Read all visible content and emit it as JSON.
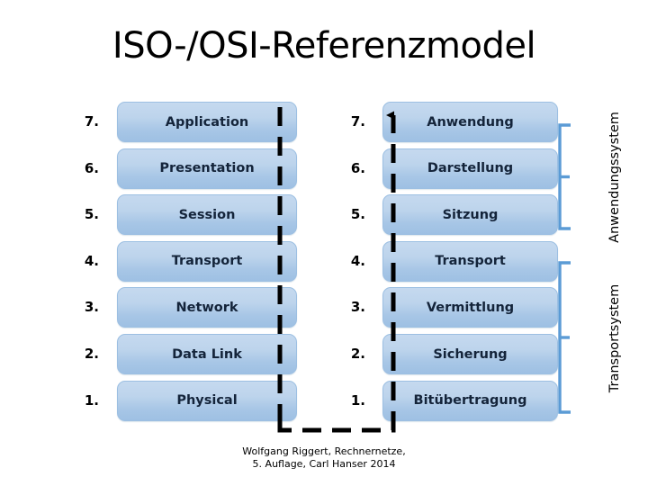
{
  "title": "ISO-/OSI-Referenzmodel",
  "colors": {
    "box_fill_top": "#c5d9ef",
    "box_fill_bottom": "#9ec0e3",
    "box_border": "#9cbfe2",
    "bracket": "#5b9bd5",
    "flow_line": "#000000",
    "text": "#000000",
    "label_text": "#14243a",
    "background": "#ffffff"
  },
  "left_column": {
    "title": "OSI layers English",
    "layers": [
      {
        "number": "7.",
        "name": "Application"
      },
      {
        "number": "6.",
        "name": "Presentation"
      },
      {
        "number": "5.",
        "name": "Session"
      },
      {
        "number": "4.",
        "name": "Transport"
      },
      {
        "number": "3.",
        "name": "Network"
      },
      {
        "number": "2.",
        "name": "Data Link"
      },
      {
        "number": "1.",
        "name": "Physical"
      }
    ]
  },
  "right_column": {
    "title": "OSI Schichten Deutsch",
    "layers": [
      {
        "number": "7.",
        "name": "Anwendung"
      },
      {
        "number": "6.",
        "name": "Darstellung"
      },
      {
        "number": "5.",
        "name": "Sitzung"
      },
      {
        "number": "4.",
        "name": "Transport"
      },
      {
        "number": "3.",
        "name": "Vermittlung"
      },
      {
        "number": "2.",
        "name": "Sicherung"
      },
      {
        "number": "1.",
        "name": "Bitübertragung"
      }
    ]
  },
  "groups": [
    {
      "label": "Anwendungssystem",
      "covers": [
        "7.",
        "6.",
        "5."
      ]
    },
    {
      "label": "Transportsystem",
      "covers": [
        "4.",
        "3.",
        "2.",
        "1."
      ]
    }
  ],
  "flow": {
    "arrow_direction": "up",
    "description": "dashed path rising from layer 1 to layer 7"
  },
  "footer": {
    "line1": "Wolfgang Riggert, Rechnernetze,",
    "line2": "5. Auflage, Carl Hanser 2014"
  }
}
